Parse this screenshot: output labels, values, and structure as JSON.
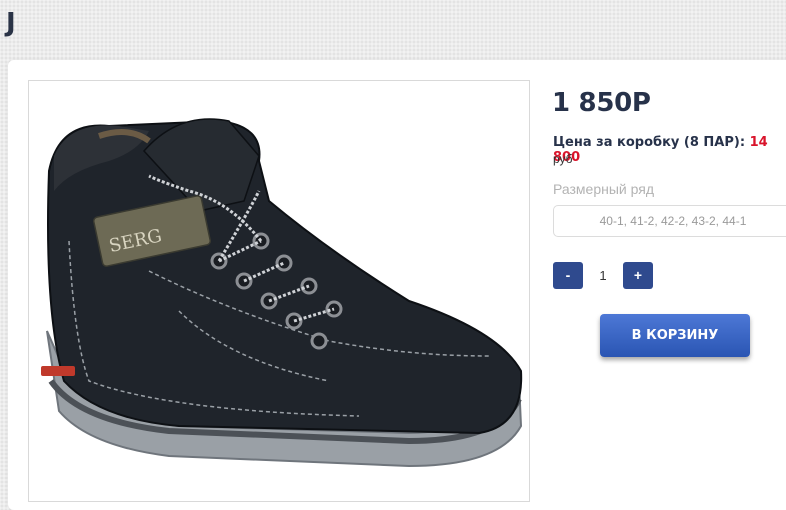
{
  "header": {
    "site_title": "J"
  },
  "product": {
    "image_alt": "Ботинки SERG",
    "brand_logo_text": "SERG",
    "price": "1 850Р",
    "box_price_label": "Цена за коробку (8 ПАР):",
    "box_price_value": "14 800",
    "box_price_unit": "руб",
    "size_range_label": "Размерный ряд",
    "size_range_value": "40-1, 41-2, 42-2, 43-2, 44-1",
    "quantity": "1",
    "minus_label": "-",
    "plus_label": "+",
    "add_to_cart_label": "В КОРЗИНУ"
  },
  "colors": {
    "primary_button": "#2f4a8e",
    "cart_button": "#3a64c4",
    "price_accent": "#d9142b",
    "text_dark": "#27324a"
  }
}
